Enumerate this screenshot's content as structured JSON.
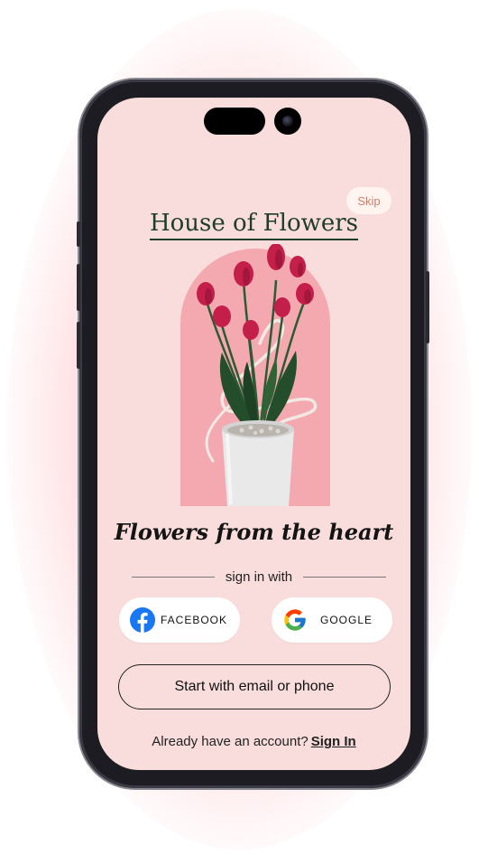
{
  "header": {
    "skip_label": "Skip",
    "app_title": "House of Flowers"
  },
  "hero": {
    "image_name": "tulip-vase-illustration",
    "tagline": "Flowers from the heart"
  },
  "auth": {
    "divider_text": "sign in with",
    "facebook_label": "FACEBOOK",
    "google_label": "GOOGLE",
    "email_phone_label": "Start with email or phone",
    "existing_account_text": "Already have an account?",
    "sign_in_link": "Sign In"
  },
  "colors": {
    "screen_bg": "#f9dcdc",
    "arch": "#f4a9b0",
    "title_green": "#1f3d2b",
    "tulip_red": "#c41e4a",
    "facebook_blue": "#1877f2"
  }
}
